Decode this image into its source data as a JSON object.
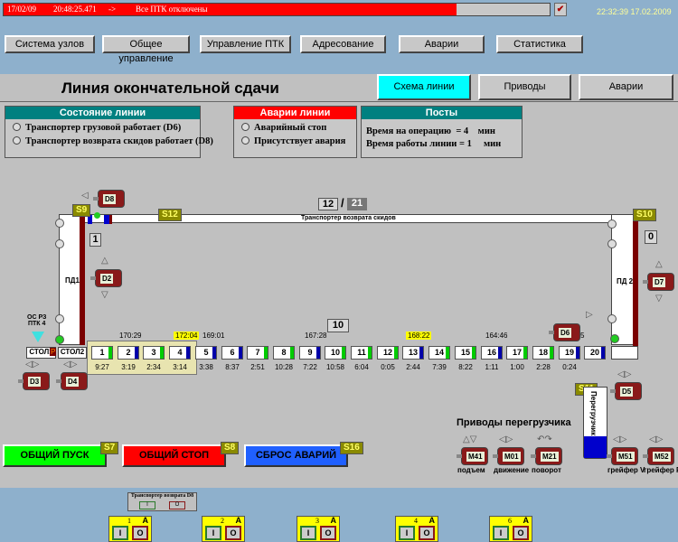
{
  "alarm_bar": {
    "date": "17/02/09",
    "time": "20:48:25.471",
    "arrow": "->",
    "message": "Все ПТК отключены",
    "fill_percent": 83
  },
  "clock": "22:32:39 17.02.2009",
  "nav": [
    "Система узлов",
    "Общее управление",
    "Управление ПТК",
    "Адресование",
    "Аварии",
    "Статистика"
  ],
  "title": "Линия окончательной сдачи",
  "tabs": [
    {
      "label": "Схема линии",
      "active": true
    },
    {
      "label": "Приводы"
    },
    {
      "label": "Аварии"
    }
  ],
  "state_panel": {
    "title": "Состояние линии",
    "items": [
      "Транспортер грузовой работает (D6)",
      "Транспортер возврата скидов работает (D8)"
    ]
  },
  "alarm_panel": {
    "title": "Аварии линии",
    "items": [
      "Аварийный стоп",
      "Присутствует авария"
    ]
  },
  "posts_panel": {
    "title": "Посты",
    "rows": [
      {
        "label": "Время на операцию",
        "eq": "=",
        "value": "4",
        "unit": "мин"
      },
      {
        "label": "Время работы линии",
        "eq": "=",
        "value": "1",
        "unit": "мин"
      }
    ]
  },
  "scheme": {
    "counter_a": "12",
    "counter_sep": "/",
    "counter_b": "21",
    "return_conveyor": "Транспортер возврата скидов",
    "box_left": "1",
    "box_right": "0",
    "box_main": "10",
    "sensors": {
      "s9": "S9",
      "s10": "S10",
      "s11": "S11",
      "s12": "S12"
    },
    "pd1": "ПД1",
    "pd2": "ПД 2",
    "station": "ОС РЗ\nПТК 4",
    "table1": "СТОЛ1",
    "table2": "СТОЛ2",
    "p": "P",
    "transfer": "Перегрузчик",
    "pallets": [
      {
        "n": "1",
        "t": "9:27",
        "s": "green"
      },
      {
        "n": "2",
        "t": "3:19",
        "s": "blue"
      },
      {
        "n": "3",
        "t": "2:34",
        "s": "green"
      },
      {
        "n": "4",
        "t": "3:14",
        "s": "blue"
      },
      {
        "n": "5",
        "t": "3:38",
        "s": "blue"
      },
      {
        "n": "6",
        "t": "8:37",
        "s": "blue"
      },
      {
        "n": "7",
        "t": "2:51",
        "s": "green"
      },
      {
        "n": "8",
        "t": "10:28",
        "s": "green"
      },
      {
        "n": "9",
        "t": "7:22",
        "s": "blue"
      },
      {
        "n": "10",
        "t": "10:58",
        "s": "green"
      },
      {
        "n": "11",
        "t": "6:04",
        "s": "green"
      },
      {
        "n": "12",
        "t": "0:05",
        "s": "green"
      },
      {
        "n": "13",
        "t": "2:44",
        "s": "blue"
      },
      {
        "n": "14",
        "t": "7:39",
        "s": "green"
      },
      {
        "n": "15",
        "t": "8:22",
        "s": "green"
      },
      {
        "n": "16",
        "t": "1:11",
        "s": "blue"
      },
      {
        "n": "17",
        "t": "1:00",
        "s": "green"
      },
      {
        "n": "18",
        "t": "2:28",
        "s": "green"
      },
      {
        "n": "19",
        "t": "0:24",
        "s": "blue"
      },
      {
        "n": "20",
        "t": "",
        "s": "blue"
      }
    ],
    "top_times": [
      {
        "v": "170:29",
        "hl": false
      },
      {
        "v": "172:04",
        "hl": true
      },
      {
        "v": "169:01",
        "hl": false
      },
      {
        "v": "167:28",
        "hl": false
      },
      {
        "v": "168:22",
        "hl": true
      },
      {
        "v": "164:46",
        "hl": false
      },
      {
        "v": "161:45",
        "hl": false
      }
    ],
    "motors": {
      "d8": "D8",
      "d2": "D2",
      "d3": "D3",
      "d4": "D4",
      "d6": "D6",
      "d7": "D7",
      "d5": "D5"
    }
  },
  "transfer_drives": {
    "title": "Приводы перегрузчика",
    "items": [
      {
        "id": "M41",
        "label": "подъем"
      },
      {
        "id": "M01",
        "label": "движение"
      },
      {
        "id": "M21",
        "label": "поворот"
      },
      {
        "id": "M51",
        "label": "грейфер V"
      },
      {
        "id": "M52",
        "label": "грейфер R"
      }
    ]
  },
  "buttons": {
    "start": "ОБЩИЙ ПУСК",
    "start_tag": "S7",
    "stop": "ОБЩИЙ СТОП",
    "stop_tag": "S8",
    "reset": "СБРОС АВАРИЙ",
    "reset_tag": "S16"
  },
  "d8_panel": {
    "title": "Транспортер возврата D8",
    "on": "I",
    "off": "O"
  },
  "posts": [
    {
      "n": "1",
      "a": "A",
      "on": "I",
      "off": "O"
    },
    {
      "n": "2",
      "a": "A",
      "on": "I",
      "off": "O"
    },
    {
      "n": "3",
      "a": "A",
      "on": "I",
      "off": "O"
    },
    {
      "n": "4",
      "a": "A",
      "on": "I",
      "off": "O"
    },
    {
      "n": "6",
      "a": "A",
      "on": "I",
      "off": "O"
    }
  ],
  "colors": {
    "green": "#00cc00",
    "blue": "#0000aa",
    "teal": "#008080",
    "alarm_red": "#ff0000",
    "active_tab": "#00ffff"
  }
}
